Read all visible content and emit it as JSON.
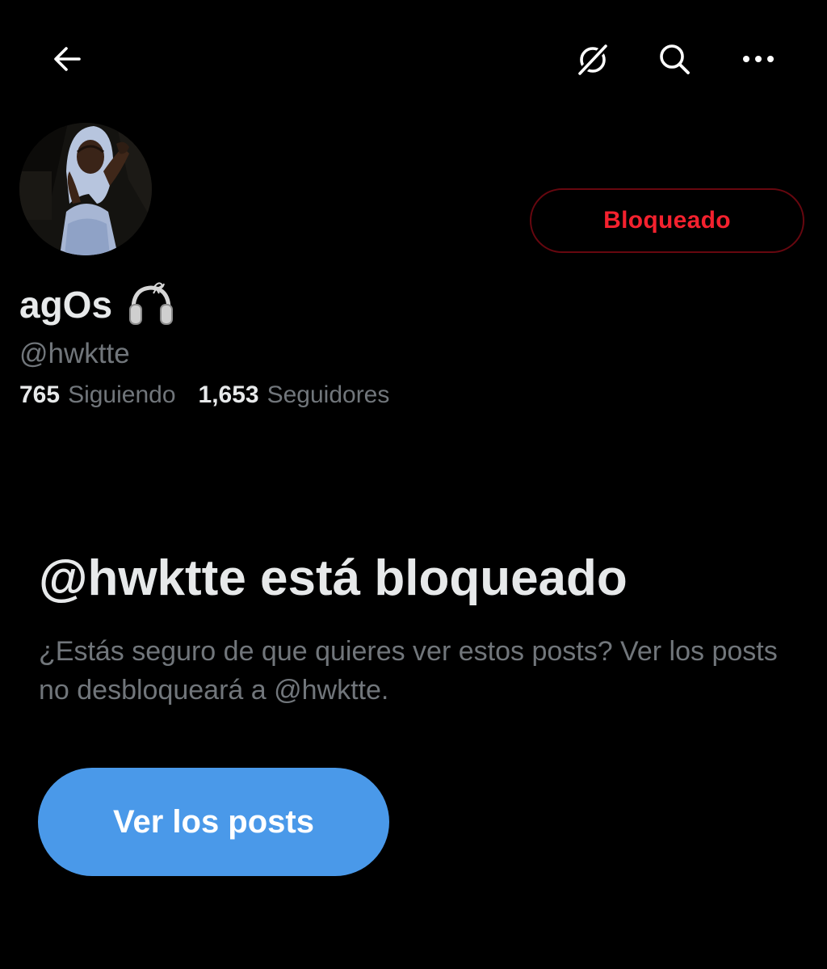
{
  "header": {
    "back_icon": "arrow-left-icon",
    "grok_icon": "grok-icon",
    "search_icon": "search-icon",
    "more_icon": "more-horizontal-icon"
  },
  "profile": {
    "display_name": "agOs",
    "name_emoji_icon": "headphones-icon",
    "handle": "@hwktte",
    "blocked_button_label": "Bloqueado",
    "following_count": "765",
    "following_label": "Siguiendo",
    "followers_count": "1,653",
    "followers_label": "Seguidores"
  },
  "blocked_notice": {
    "title": "@hwktte está bloqueado",
    "description": "¿Estás seguro de que quieres ver estos posts? Ver los posts no desbloqueará a @hwktte.",
    "view_button_label": "Ver los posts"
  },
  "colors": {
    "background": "#000000",
    "primary_text": "#e7e9ea",
    "secondary_text": "#71767b",
    "blocked_red": "#f4212e",
    "accent_blue": "#4a99e9"
  }
}
